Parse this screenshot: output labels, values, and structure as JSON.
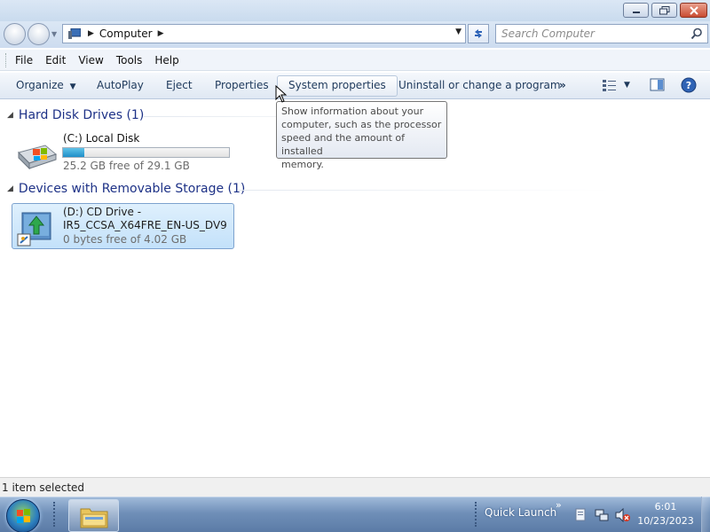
{
  "window": {
    "buttons": [
      "minimize-icon",
      "restore-icon",
      "close-icon"
    ]
  },
  "address": {
    "crumb": "Computer",
    "icon": "computer-icon"
  },
  "search": {
    "placeholder": "Search Computer"
  },
  "menu": {
    "items": [
      "File",
      "Edit",
      "View",
      "Tools",
      "Help"
    ]
  },
  "commands": {
    "organize": "Organize",
    "autoplay": "AutoPlay",
    "eject": "Eject",
    "properties": "Properties",
    "system_properties": "System properties",
    "uninstall": "Uninstall or change a program",
    "more": "»"
  },
  "groups": {
    "hard_disk": "Hard Disk Drives (1)",
    "removable": "Devices with Removable Storage (1)"
  },
  "drives": [
    {
      "name": "(C:) Local Disk",
      "free_text": "25.2 GB free of 29.1 GB",
      "used_fraction": 0.13,
      "icon": "hard-disk-icon"
    },
    {
      "name_line1": "(D:) CD Drive -",
      "name_line2": "IR5_CCSA_X64FRE_EN-US_DV9",
      "free_text": "0 bytes free of 4.02 GB",
      "icon": "cd-drive-icon",
      "selected": true
    }
  ],
  "tooltip": {
    "line1": "Show information about your",
    "line2": "computer, such as the processor",
    "line3": "speed and the amount of installed",
    "line4": "memory."
  },
  "status": {
    "text": "1 item selected"
  },
  "taskbar": {
    "quick_launch": "Quick Launch",
    "chevron": "»",
    "time": "6:01",
    "date": "10/23/2023"
  },
  "colors": {
    "group_header": "#1e3287",
    "selection": "#c3e1fa",
    "progress_fill": "#1f8fc8"
  }
}
